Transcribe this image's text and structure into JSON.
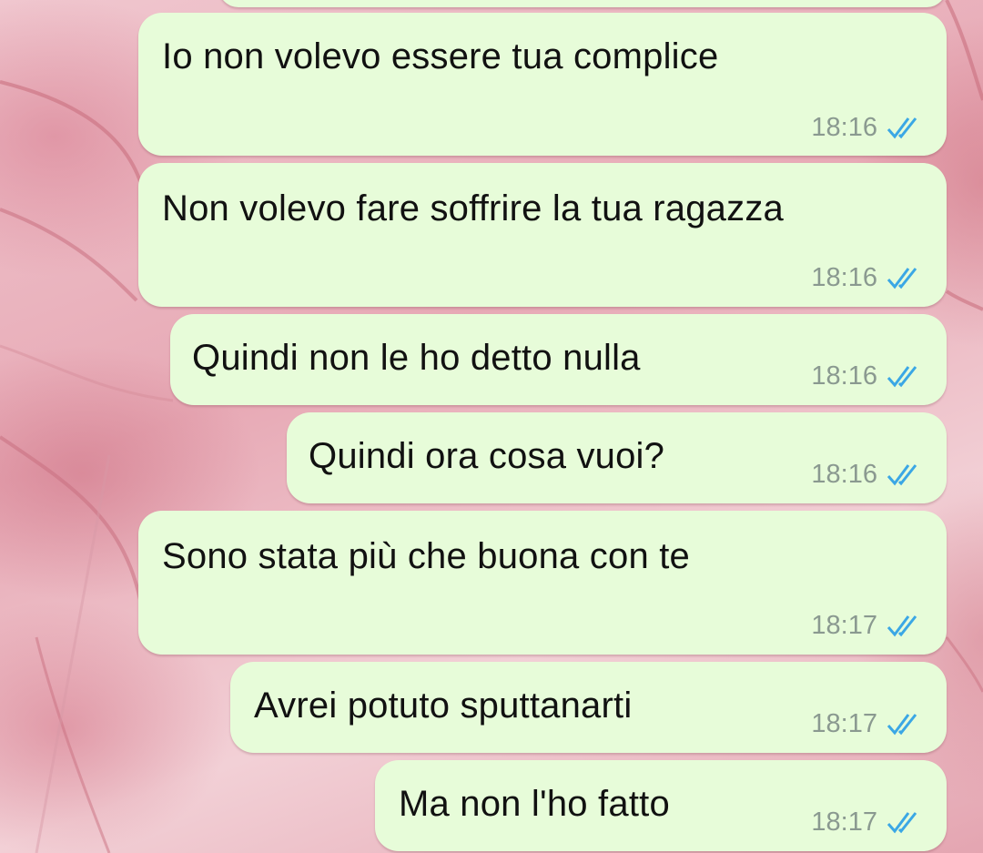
{
  "chat": {
    "messages": [
      {
        "text": "Io non volevo essere tua complice",
        "time": "18:16",
        "status": "read"
      },
      {
        "text": "Non volevo fare soffrire la tua ragazza",
        "time": "18:16",
        "status": "read"
      },
      {
        "text": "Quindi non le ho detto nulla",
        "time": "18:16",
        "status": "read"
      },
      {
        "text": "Quindi ora cosa vuoi?",
        "time": "18:16",
        "status": "read"
      },
      {
        "text": "Sono stata più che buona con te",
        "time": "18:17",
        "status": "read"
      },
      {
        "text": "Avrei potuto sputtanarti",
        "time": "18:17",
        "status": "read"
      },
      {
        "text": "Ma non l'ho fatto",
        "time": "18:17",
        "status": "read"
      }
    ]
  },
  "colors": {
    "outgoing_bubble": "#e7fcd9",
    "read_ticks": "#3ba7e5",
    "timestamp": "#8a9990",
    "wallpaper": "#e9b3bd"
  },
  "icons": {
    "read_receipt": "double-check-icon"
  }
}
